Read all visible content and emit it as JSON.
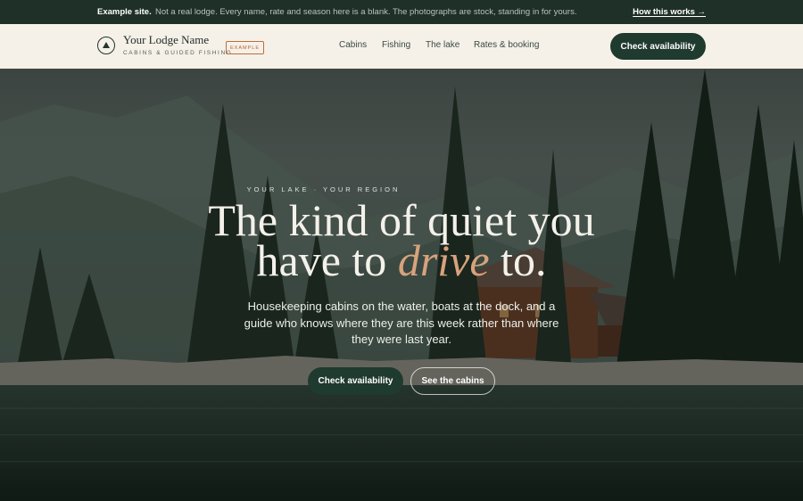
{
  "notice": {
    "label": "Example site.",
    "text": "Not a real lodge. Every name, rate and season here is a blank. The photographs are stock, standing in for yours.",
    "link": "How this works →"
  },
  "header": {
    "brand_name": "Your Lodge Name",
    "brand_tagline": "CABINS & GUIDED FISHING",
    "badge": "EXAMPLE",
    "nav": [
      "Cabins",
      "Fishing",
      "The lake",
      "Rates & booking"
    ],
    "cta": "Check availability"
  },
  "hero": {
    "eyebrow": "YOUR LAKE · YOUR REGION",
    "headline_line1": "The kind of quiet you",
    "headline_pre": "have to ",
    "headline_em": "drive",
    "headline_post": " to.",
    "subtext": "Housekeeping cabins on the water, boats at the dock, and a guide who knows where they are this week rather than where they were last year.",
    "primary_button": "Check availability",
    "secondary_button": "See the cabins"
  },
  "icons": {
    "logo": "mountain-triangle-icon"
  },
  "colors": {
    "accent_green": "#1f3a2e",
    "badge_orange": "#b9622f",
    "headline_em": "#d7a27c",
    "header_bg": "#f5f1e8"
  }
}
